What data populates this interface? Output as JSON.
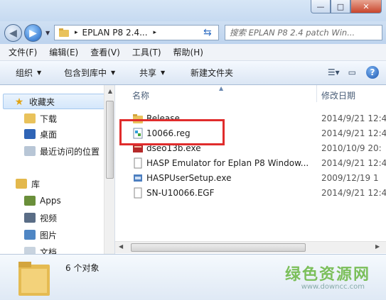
{
  "window": {
    "minimize": "—",
    "maximize": "□",
    "close": "✕"
  },
  "address": {
    "path": "EPLAN P8 2.4...",
    "separator": "▸",
    "search_placeholder": "搜索 EPLAN P8 2.4 patch Win..."
  },
  "menu": [
    "文件(F)",
    "编辑(E)",
    "查看(V)",
    "工具(T)",
    "帮助(H)"
  ],
  "toolbar": {
    "organize": "组织",
    "include_in_library": "包含到库中",
    "share": "共享",
    "new_folder": "新建文件夹",
    "help": "?"
  },
  "nav": {
    "favorites": "收藏夹",
    "favorites_items": [
      "下载",
      "桌面",
      "最近访问的位置"
    ],
    "libraries": "库",
    "library_items": [
      "Apps",
      "视频",
      "图片",
      "文档"
    ]
  },
  "columns": {
    "name": "名称",
    "date": "修改日期"
  },
  "files": [
    {
      "name": "Release",
      "date": "2014/9/21 12:4",
      "icon": "folder-icon"
    },
    {
      "name": "10066.reg",
      "date": "2014/9/21 12:4",
      "icon": "registry-file-icon"
    },
    {
      "name": "dseo13b.exe",
      "date": "2010/10/9 20:",
      "icon": "exe-icon"
    },
    {
      "name": "HASP Emulator for Eplan P8 Window...",
      "date": "2014/9/21 12:4",
      "icon": "document-icon"
    },
    {
      "name": "HASPUserSetup.exe",
      "date": "2009/12/19 1",
      "icon": "setup-exe-icon"
    },
    {
      "name": "SN-U10066.EGF",
      "date": "2014/9/21 12:4",
      "icon": "document-icon"
    }
  ],
  "details": {
    "count": "6 个对象"
  },
  "watermark": {
    "text": "绿色资源网",
    "url": "www.downcc.com"
  },
  "colors": {
    "highlight_box": "#e02c2c",
    "folder": "#e9c25b",
    "accent": "#1c56b0"
  }
}
